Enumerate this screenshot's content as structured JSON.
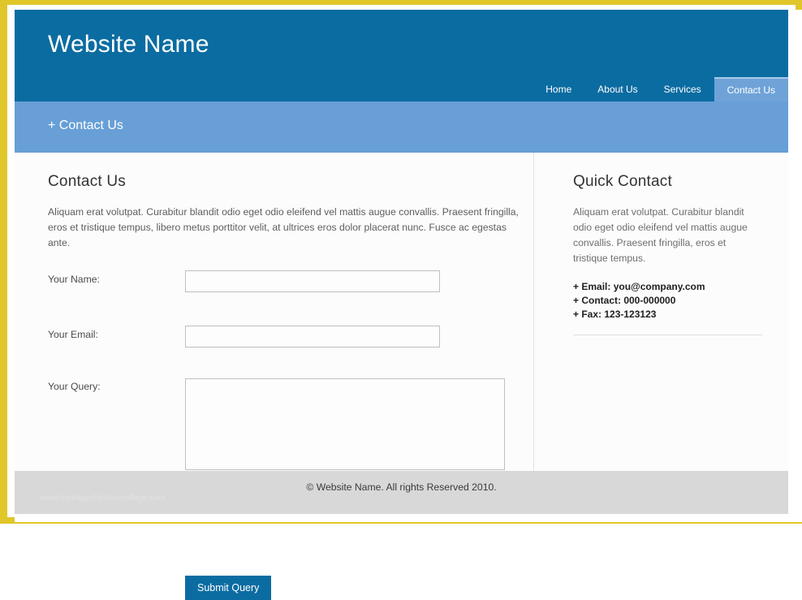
{
  "page": {
    "frame_color": "#E0C62B",
    "header_color": "#0B6CA1",
    "breadcrumb_color": "#679FD6",
    "accent_color": "#0B6CA1",
    "footer_color": "#D8D8D8"
  },
  "header": {
    "site_title": "Website Name",
    "nav": [
      {
        "label": "Home",
        "active": false
      },
      {
        "label": "About Us",
        "active": false
      },
      {
        "label": "Services",
        "active": false
      },
      {
        "label": "Contact Us",
        "active": true
      }
    ]
  },
  "breadcrumb": {
    "text": "+ Contact Us"
  },
  "main": {
    "heading": "Contact Us",
    "intro": "Aliquam erat volutpat. Curabitur blandit odio eget odio eleifend vel mattis augue convallis. Praesent fringilla, eros et tristique tempus, libero metus porttitor velit, at ultrices eros dolor placerat nunc. Fusce ac egestas ante.",
    "form": {
      "name_label": "Your Name:",
      "name_value": "",
      "name_placeholder": "",
      "email_label": "Your Email:",
      "email_value": "",
      "email_placeholder": "",
      "query_label": "Your Query:",
      "query_value": "",
      "query_placeholder": "",
      "submit_label": "Submit Query"
    }
  },
  "sidebar": {
    "heading": "Quick Contact",
    "intro": "Aliquam erat volutpat. Curabitur blandit odio eget odio eleifend vel mattis augue convallis. Praesent fringilla, eros et tristique tempus.",
    "details": [
      {
        "label": "+ Email: you@company.com"
      },
      {
        "label": "+ Contact: 000-000000"
      },
      {
        "label": "+ Fax: 123-123123"
      }
    ]
  },
  "footer": {
    "copyright": "© Website Name. All rights Reserved 2010.",
    "watermark": "www.heritagechristiancollege.com"
  }
}
